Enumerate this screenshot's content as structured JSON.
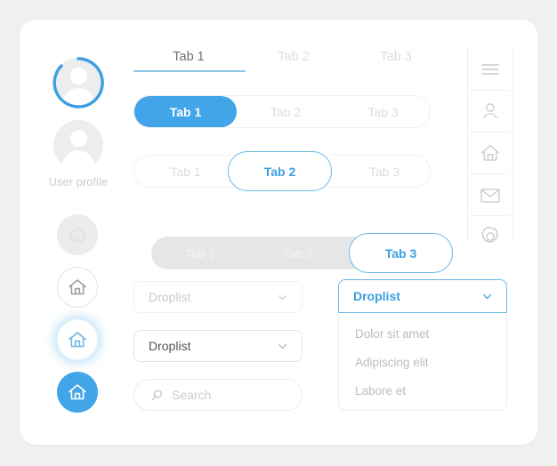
{
  "colors": {
    "accent": "#42a5e8",
    "accent_border": "#6cb8e5",
    "accent_text": "#3b9fe0",
    "page_bg": "#f0f0f0",
    "card_bg": "#ffffff",
    "muted_text": "#dcdddf",
    "gray_track": "#e6e6e6",
    "icon_gray": "#c6c8ca"
  },
  "profile": {
    "label": "User profile",
    "progress_ring_color": "#3b9fe0",
    "avatar_icon": "person-icon"
  },
  "home_buttons": [
    {
      "state": "disabled",
      "icon": "home-icon"
    },
    {
      "state": "default",
      "icon": "home-icon"
    },
    {
      "state": "focused",
      "icon": "home-icon"
    },
    {
      "state": "active",
      "icon": "home-icon"
    }
  ],
  "underline_tabs": {
    "items": [
      {
        "label": "Tab 1",
        "selected": true
      },
      {
        "label": "Tab 2",
        "selected": false
      },
      {
        "label": "Tab 3",
        "selected": false
      }
    ]
  },
  "tab_groups": [
    {
      "style": "solid-white-track",
      "items": [
        {
          "label": "Tab 1",
          "selected": true
        },
        {
          "label": "Tab 2",
          "selected": false
        },
        {
          "label": "Tab 3",
          "selected": false
        }
      ]
    },
    {
      "style": "outline-white-track",
      "items": [
        {
          "label": "Tab 1",
          "selected": false
        },
        {
          "label": "Tab 2",
          "selected": true
        },
        {
          "label": "Tab 3",
          "selected": false
        }
      ]
    },
    {
      "style": "outline-gray-track",
      "items": [
        {
          "label": "Tab 1",
          "selected": false
        },
        {
          "label": "Tab 2",
          "selected": false
        },
        {
          "label": "Tab 3",
          "selected": true
        }
      ]
    }
  ],
  "droplists": {
    "muted": {
      "label": "Droplist",
      "icon": "chevron-down-icon"
    },
    "normal": {
      "label": "Droplist",
      "icon": "chevron-down-icon"
    },
    "open": {
      "label": "Droplist",
      "icon": "chevron-down-icon",
      "options": [
        "Dolor sit amet",
        "Adipiscing elit",
        "Labore et"
      ]
    }
  },
  "search": {
    "placeholder": "Search",
    "value": "",
    "icon": "search-icon"
  },
  "icon_rail": {
    "items": [
      {
        "name": "menu-icon"
      },
      {
        "name": "person-icon"
      },
      {
        "name": "home-icon"
      },
      {
        "name": "mail-icon"
      },
      {
        "name": "gear-icon"
      }
    ]
  }
}
